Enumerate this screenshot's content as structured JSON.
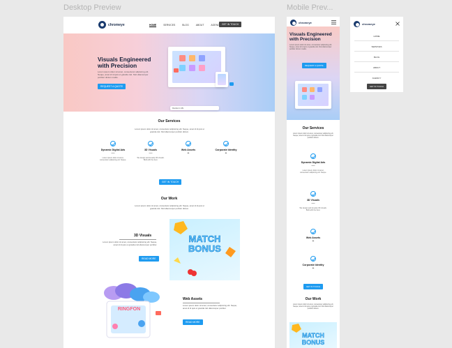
{
  "frames": {
    "desktop_label": "Desktop Preview",
    "mobile_label": "Mobile Prev..."
  },
  "brand": {
    "name": "chromeye"
  },
  "nav": {
    "links": [
      "HOME",
      "SERVICES",
      "BLOG",
      "ABOUT",
      "AGENCY"
    ],
    "cta": "GET IN TOUCH"
  },
  "hero": {
    "title": "Visuals Engineered with Precision",
    "body": "Lorem ipsum dolor sit amet, consectetur adipiscing elit. Neque, amet id id quis ut gravida nisl. Nisl ullamcorper porttitor dictum mattis.",
    "cta": "REQUEST A QUOTE",
    "mock_label": "Renders LIVE"
  },
  "services": {
    "title": "Our Services",
    "intro": "Lorem ipsum dolor sit amet, consectetur adipiscing elit. Neque, amet id id quis ut gravida nisl. Nisl ullamcorper porttitor dictum.",
    "items": [
      {
        "name": "Dynamic Digital Ads",
        "desc": "Lorem ipsum dolor sit amet, consectetur adipiscing elit. Neque.",
        "toggle": "—"
      },
      {
        "name": "3D Visuals",
        "desc": "We design and develop 3D visuals. Built with the best.",
        "toggle": "—"
      },
      {
        "name": "Web Assets",
        "desc": "",
        "toggle": "+"
      },
      {
        "name": "Corporate Identity",
        "desc": "",
        "toggle": "+"
      }
    ],
    "cta": "GET IN TOUCH"
  },
  "work": {
    "title": "Our Work",
    "intro": "Lorem ipsum dolor sit amet, consectetur adipiscing elit. Neque, amet id id quis ut gravida nisl. Nisl ullamcorper porttitor dictum.",
    "projects": [
      {
        "name": "3D Visuals",
        "text": "Lorem ipsum dolor sit amet, consectetur adipiscing elit. Neque, amet id id quis ut gravida nisl ullamcorper porttitor.",
        "cta": "READ MORE",
        "image_text": "MATCH BONUS"
      },
      {
        "name": "Web Assets",
        "text": "Lorem ipsum dolor sit amet, consectetur adipiscing elit. Neque, amet id id quis ut gravida nisl ullamcorper porttitor.",
        "cta": "READ MORE",
        "image_text": "RINGFON"
      }
    ]
  },
  "mobile_menu": {
    "items": [
      "HOME",
      "SERVICES",
      "BLOG",
      "ABOUT",
      "AGENCY"
    ],
    "cta": "GET IN TOUCH"
  },
  "colors": {
    "accent": "#1e9bf0",
    "dark_button": "#444444",
    "heading": "#15213a"
  },
  "icons": [
    "hamburger-icon",
    "close-icon",
    "check-circle-icon"
  ]
}
